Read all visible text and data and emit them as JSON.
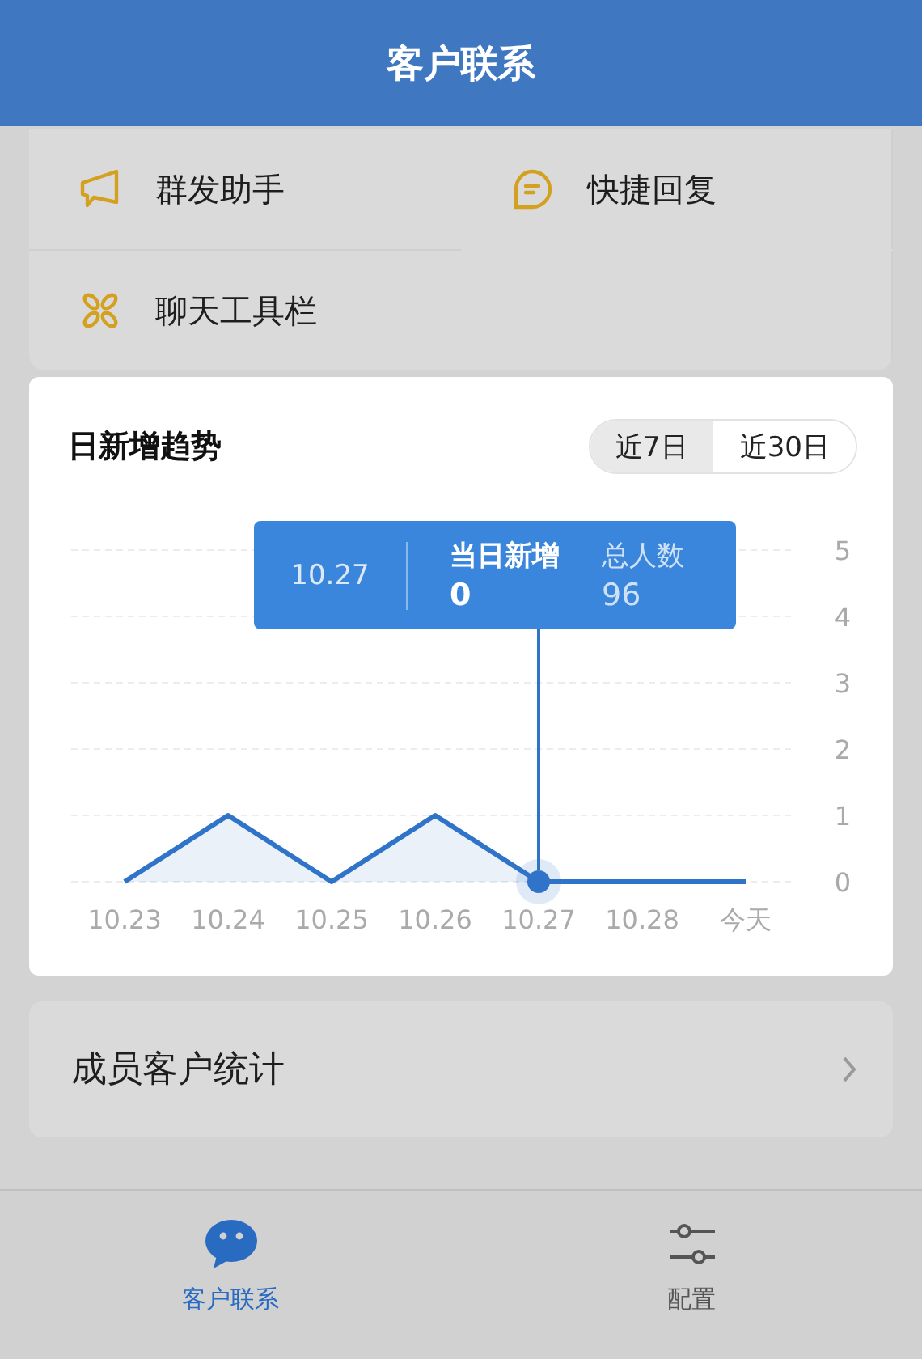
{
  "header": {
    "title": "客户联系"
  },
  "tools": [
    {
      "label": "群发助手"
    },
    {
      "label": "快捷回复"
    },
    {
      "label": "聊天工具栏"
    }
  ],
  "trend": {
    "title": "日新增趋势",
    "ranges": [
      {
        "label": "近7日",
        "selected": true
      },
      {
        "label": "近30日",
        "selected": false
      }
    ],
    "chart_data": {
      "type": "line",
      "grid": true,
      "categories": [
        "10.23",
        "10.24",
        "10.25",
        "10.26",
        "10.27",
        "10.28",
        "今天"
      ],
      "series": [
        {
          "name": "当日新增",
          "color": "#2f74c8",
          "values": [
            0,
            1,
            0,
            1,
            0,
            0,
            0
          ]
        }
      ],
      "ylim": [
        0,
        5
      ],
      "yticks": [
        0,
        1,
        2,
        3,
        4,
        5
      ]
    },
    "selected_points": [
      false,
      false,
      false,
      false,
      true,
      false,
      false
    ],
    "tooltip": {
      "date": "10.27",
      "value": "0",
      "total": {
        "label": "总人数",
        "value": "96"
      }
    }
  },
  "stats": {
    "label": "成员客户统计"
  },
  "tab_bar": [
    {
      "label": "客户联系",
      "selected": true
    },
    {
      "label": "配置",
      "selected": false
    }
  ]
}
